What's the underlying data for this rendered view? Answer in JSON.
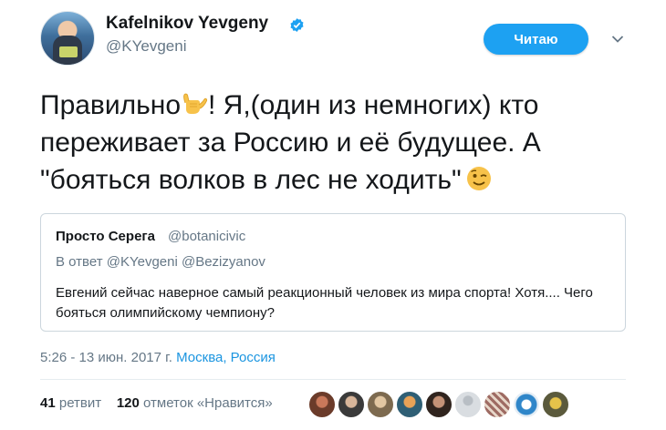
{
  "author": {
    "name": "Kafelnikov Yevgeny",
    "handle": "@KYevgeni"
  },
  "follow_button": {
    "label": "Читаю"
  },
  "tweet": {
    "line1_a": "Правильно",
    "line1_b": "! Я,(один из немногих) кто",
    "line2": "переживает за Россию и её будущее. А",
    "line3": "\"бояться волков в лес не ходить\""
  },
  "quote": {
    "name": "Просто Серега",
    "handle": "@botanicivic",
    "reply_prefix": "В ответ",
    "reply_to_1": "@KYevgeni",
    "reply_to_2": "@Bezizyanov",
    "body": "Евгений сейчас наверное самый реакционный человек из мира спорта! Хотя.... Чего бояться олимпийскому чемпиону?"
  },
  "meta": {
    "time_date": "5:26 - 13 июн. 2017 г.",
    "location": "Москва, Россия"
  },
  "stats": {
    "retweets_count": "41",
    "retweets_label": "ретвит",
    "likes_count": "120",
    "likes_label": "отметок «Нравится»"
  },
  "colors": {
    "accent": "#1da1f2",
    "link": "#1b95e0",
    "muted": "#657786",
    "text": "#14171a"
  },
  "icons": {
    "verified": "verified-badge-icon",
    "chevron": "chevron-down-icon",
    "emoji_1": "call-me-hand-emoji",
    "emoji_2": "winking-face-emoji"
  }
}
